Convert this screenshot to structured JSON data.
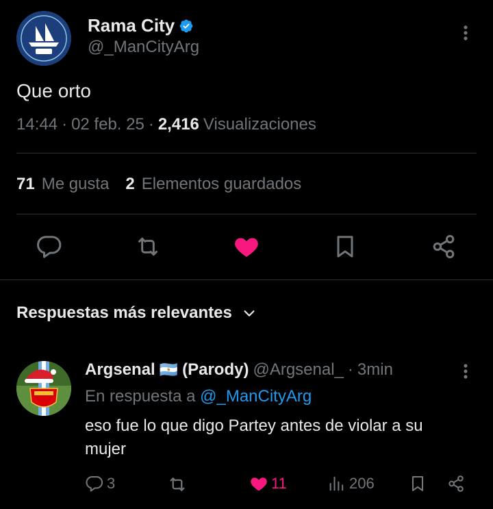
{
  "tweet": {
    "author_name": "Rama City",
    "author_handle": "@_ManCityArg",
    "text": "Que orto",
    "time": "14:44",
    "date": "02 feb. 25",
    "views_count": "2,416",
    "views_label": "Visualizaciones",
    "likes_count": "71",
    "likes_label": "Me gusta",
    "bookmarks_count": "2",
    "bookmarks_label": "Elementos guardados",
    "liked": true,
    "colors": {
      "verified": "#1d9bf0",
      "liked": "#f91880",
      "background": "#000000"
    }
  },
  "replies_section": {
    "sort_label": "Respuestas más relevantes"
  },
  "reply": {
    "author_name": "Argsenal",
    "flag": "🇦🇷",
    "author_suffix": "(Parody)",
    "author_handle": "@Argsenal_",
    "time": "3min",
    "reply_to_prefix": "En respuesta a",
    "reply_to_handle": "@_ManCityArg",
    "text": "eso fue lo que digo Partey antes de violar a su mujer",
    "reply_count": "3",
    "like_count": "11",
    "view_count": "206",
    "liked": true
  }
}
